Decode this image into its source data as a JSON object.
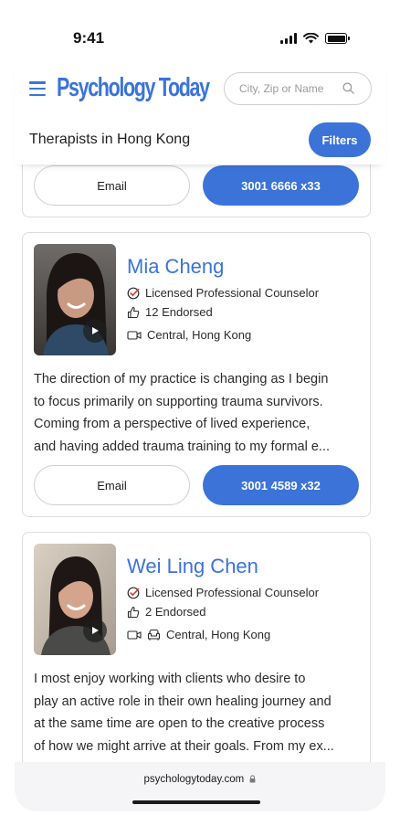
{
  "status_bar": {
    "time": "9:41"
  },
  "header": {
    "logo": "Psychology Today",
    "search_placeholder": "City, Zip or Name",
    "page_title": "Therapists in Hong Kong",
    "filters_label": "Filters"
  },
  "cards": [
    {
      "email_label": "Email",
      "phone_label": "3001 6666 x33"
    },
    {
      "name": "Mia Cheng",
      "title": "Licensed Professional Counselor",
      "endorsed": "12 Endorsed",
      "location": "Central, Hong Kong",
      "bio": [
        "The direction of my practice is changing as I begin",
        "to focus primarily on supporting trauma survivors.",
        "Coming from a perspective of lived experience,",
        "and having added trauma training to my formal e..."
      ],
      "email_label": "Email",
      "phone_label": "3001 4589 x32"
    },
    {
      "name": "Wei Ling Chen",
      "title": "Licensed Professional Counselor",
      "endorsed": "2 Endorsed",
      "location": "Central, Hong Kong",
      "bio": [
        "I most enjoy working with clients who desire to",
        "play an active role in their own healing journey and",
        "at the same time are open to the creative process",
        "of how we might arrive at their goals. From my ex..."
      ]
    }
  ],
  "browser": {
    "url": "psychologytoday.com"
  },
  "colors": {
    "accent": "#3b73d9",
    "border": "#dcdcdc"
  },
  "icons": [
    "menu-icon",
    "search-icon",
    "play-icon",
    "verified-check-icon",
    "thumbs-up-icon",
    "video-icon",
    "in-person-icon",
    "lock-icon"
  ]
}
